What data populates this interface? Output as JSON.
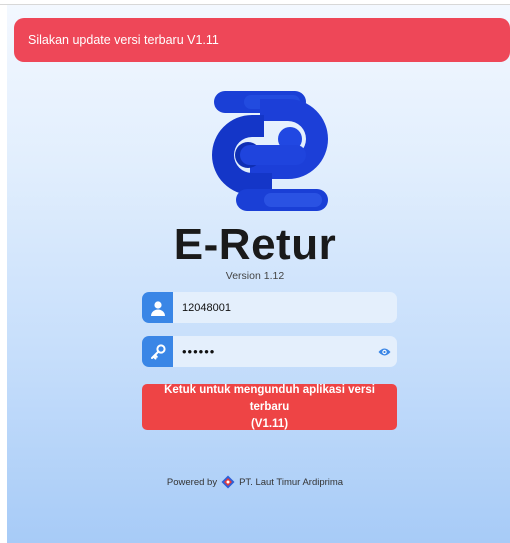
{
  "alert": {
    "text": "Silakan update versi terbaru V1.11"
  },
  "brand": {
    "name": "E-Retur",
    "version": "Version 1.12"
  },
  "login": {
    "username_value": "12048001",
    "password_value": "••••••"
  },
  "download_button": {
    "line1": "Ketuk untuk mengunduh aplikasi versi terbaru",
    "line2": "(V1.11)"
  },
  "footer": {
    "powered_label": "Powered by",
    "company": "PT. Laut Timur Ardiprima"
  },
  "icons": {
    "user": "user-icon",
    "key": "key-icon",
    "eye": "eye-icon",
    "logo": "e-retur-logo",
    "company_logo": "company-logo-icon"
  },
  "colors": {
    "alert_bg": "#ee4758",
    "accent_blue": "#3a86e6",
    "logo_blue": "#1c3fd8",
    "button_red": "#ee4445"
  }
}
